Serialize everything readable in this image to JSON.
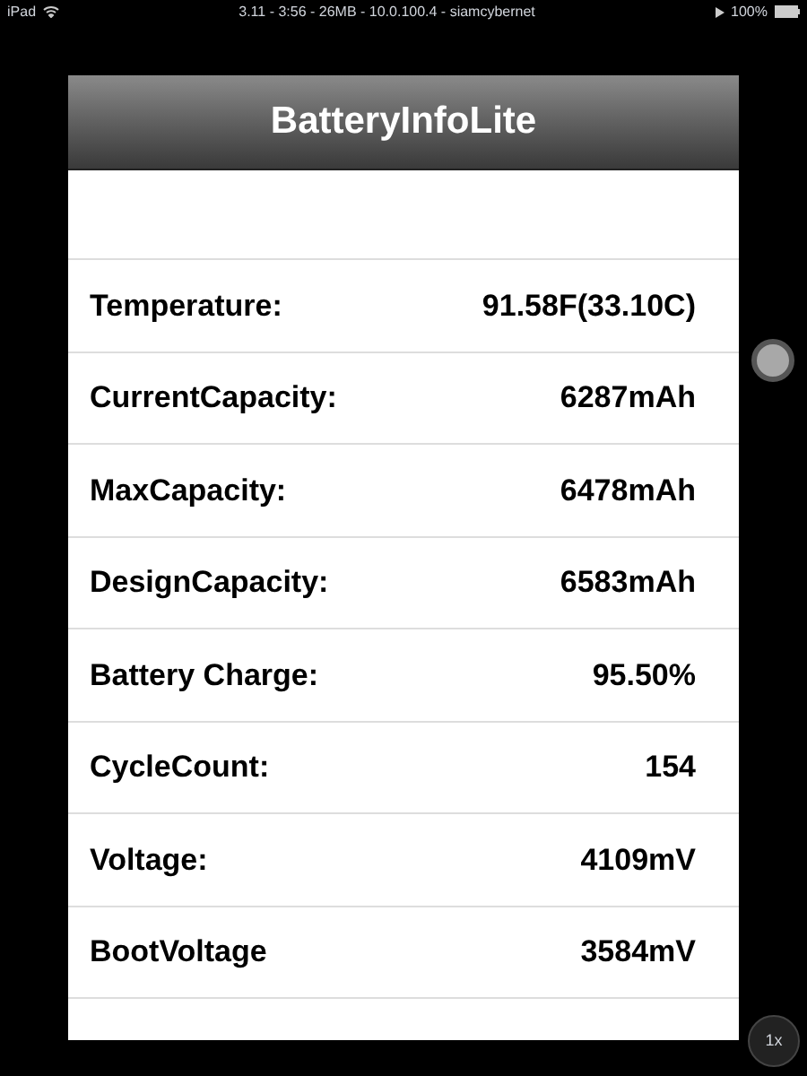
{
  "status_bar": {
    "device": "iPad",
    "center": "3.11 - 3:56 - 26MB - 10.0.100.4 - siamcybernet",
    "battery": "100%"
  },
  "app": {
    "title": "BatteryInfoLite"
  },
  "rows": [
    {
      "label": "Temperature:",
      "value": "91.58F(33.10C)"
    },
    {
      "label": "CurrentCapacity:",
      "value": "6287mAh"
    },
    {
      "label": "MaxCapacity:",
      "value": "6478mAh"
    },
    {
      "label": "DesignCapacity:",
      "value": "6583mAh"
    },
    {
      "label": "Battery Charge:",
      "value": "95.50%"
    },
    {
      "label": "CycleCount:",
      "value": "154"
    },
    {
      "label": "Voltage:",
      "value": "4109mV"
    },
    {
      "label": "BootVoltage",
      "value": "3584mV"
    }
  ],
  "zoom_button": "1x"
}
